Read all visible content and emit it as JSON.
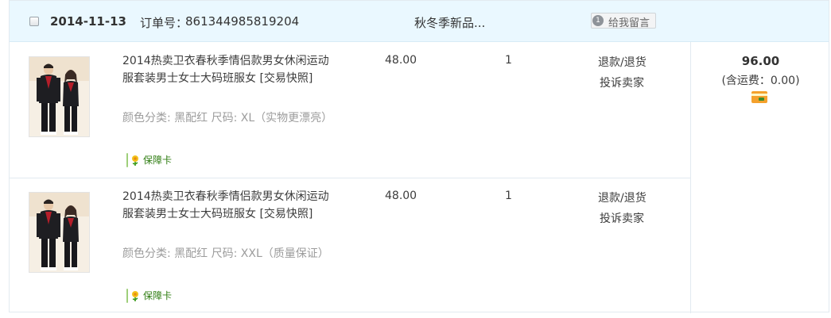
{
  "order": {
    "date": "2014-11-13",
    "order_no_label": "订单号：",
    "order_no": "861344985819204",
    "shop_name": "秋冬季新品...",
    "message_button": {
      "count": "1",
      "label": "给我留言"
    },
    "total": "96.00",
    "shipping": "(含运费：0.00)",
    "pay_icon": "credit-card-icon"
  },
  "items": [
    {
      "title": "2014热卖卫衣春秋季情侣款男女休闲运动服套装男士女士大码班服女 [交易快照]",
      "sku": "颜色分类: 黑配红  尺码: XL（实物更漂亮）",
      "badge": "保障卡",
      "price": "48.00",
      "quantity": "1",
      "op_refund": "退款/退货",
      "op_complain": "投诉卖家"
    },
    {
      "title": "2014热卖卫衣春秋季情侣款男女休闲运动服套装男士女士大码班服女 [交易快照]",
      "sku": "颜色分类: 黑配红  尺码: XXL（质量保证）",
      "badge": "保障卡",
      "price": "48.00",
      "quantity": "1",
      "op_refund": "退款/退货",
      "op_complain": "投诉卖家"
    }
  ]
}
